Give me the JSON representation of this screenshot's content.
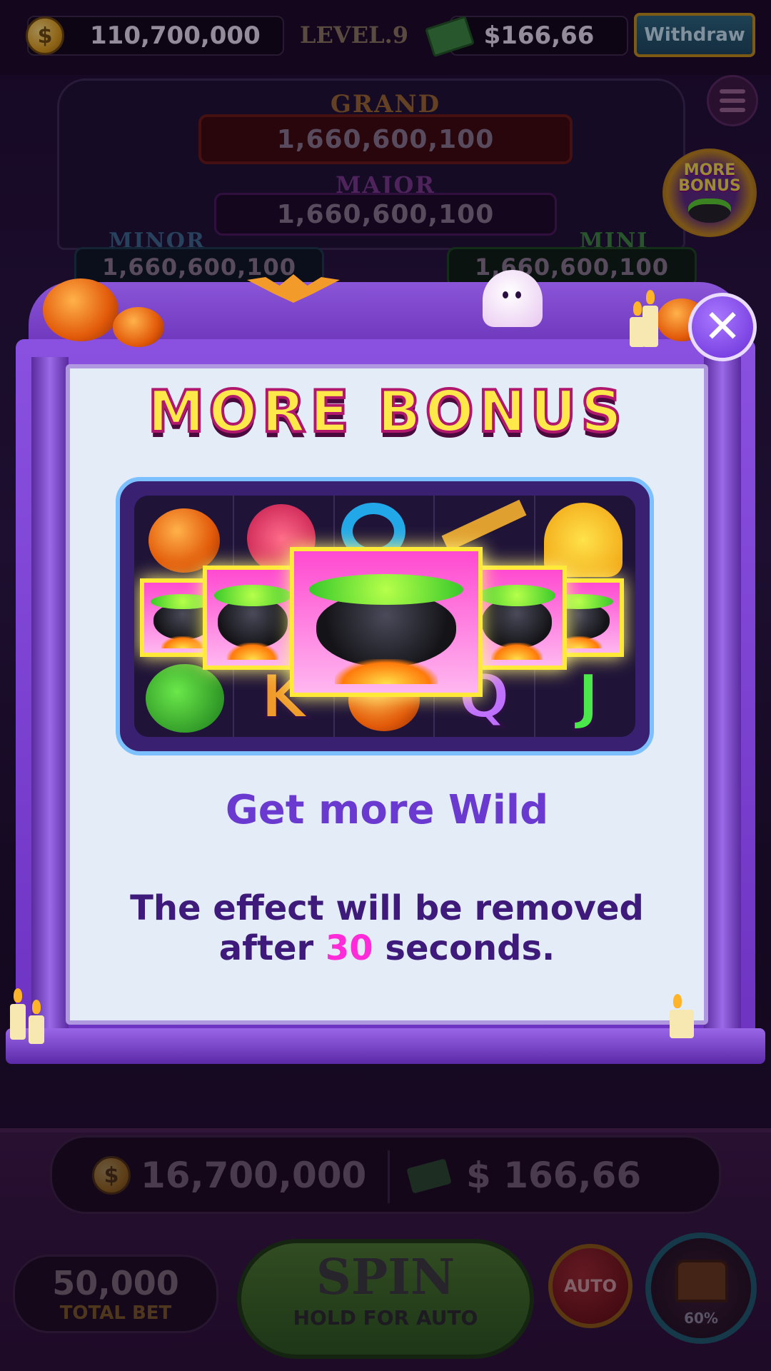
{
  "top_bar": {
    "coins": "110,700,000",
    "level": "LEVEL.9",
    "cash": "$166,66",
    "withdraw_label": "Withdraw"
  },
  "jackpots": {
    "grand": {
      "label": "GRAND",
      "value": "1,660,600,100"
    },
    "major": {
      "label": "MAJOR",
      "value": "1,660,600,100"
    },
    "minor": {
      "label": "MINOR",
      "value": "1,660,600,100"
    },
    "mini": {
      "label": "MINI",
      "value": "1,660,600,100"
    }
  },
  "more_bonus_badge": {
    "line1": "MORE",
    "line2": "BONUS"
  },
  "modal": {
    "title": "MORE BONUS",
    "heading": "Get more Wild",
    "desc_line1": "The effect will be removed",
    "desc_before": "after ",
    "desc_highlight": "30",
    "desc_after": " seconds.",
    "close_icon": "close-icon"
  },
  "reels": {
    "letters": {
      "k": "K",
      "q": "Q",
      "j": "J"
    },
    "symbols": [
      "pumpkin",
      "skull-candy",
      "s-letter",
      "broom",
      "ghost",
      "cauldron",
      "spider",
      "k-letter",
      "pumpkin",
      "q-letter",
      "j-letter"
    ]
  },
  "bottom": {
    "coin_balance": "16,700,000",
    "cash_balance": "$ 166,66",
    "total_bet_value": "50,000",
    "total_bet_label": "TOTAL BET",
    "spin_label": "SPIN",
    "spin_sublabel": "HOLD FOR AUTO",
    "auto_label": "AUTO",
    "chest_progress": "60%"
  },
  "colors": {
    "accent_purple": "#6a3ad0",
    "highlight_pink": "#ff2ad8",
    "title_yellow": "#ffe84a"
  }
}
